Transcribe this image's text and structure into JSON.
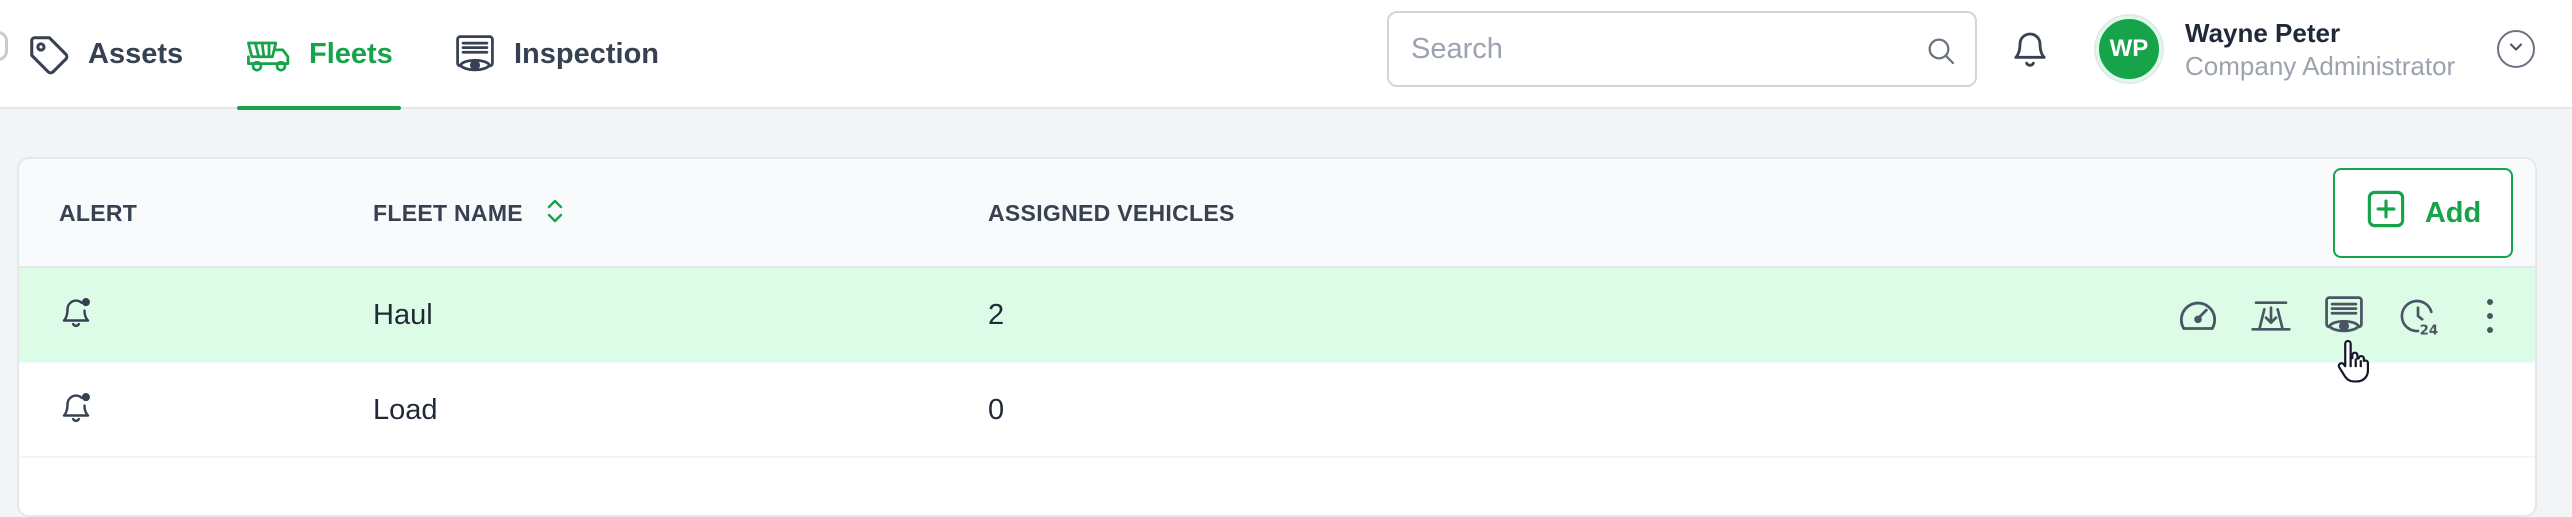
{
  "nav": {
    "tabs": [
      {
        "label": "Assets",
        "icon": "tag-icon",
        "active": false
      },
      {
        "label": "Fleets",
        "icon": "fleet-vehicle-icon",
        "active": true
      },
      {
        "label": "Inspection",
        "icon": "inspection-eye-icon",
        "active": false
      }
    ]
  },
  "search": {
    "placeholder": "Search",
    "value": ""
  },
  "user": {
    "initials": "WP",
    "name": "Wayne Peter",
    "role": "Company Administrator"
  },
  "table": {
    "columns": {
      "alert": "ALERT",
      "fleet_name": "FLEET NAME",
      "assigned_vehicles": "ASSIGNED VEHICLES"
    },
    "add_label": "Add",
    "rows": [
      {
        "alert_icon": "bell-alert-icon",
        "fleet_name": "Haul",
        "assigned_vehicles": "2",
        "highlighted": true
      },
      {
        "alert_icon": "bell-alert-icon",
        "fleet_name": "Load",
        "assigned_vehicles": "0",
        "highlighted": false
      }
    ],
    "row_actions": [
      "speedometer-icon",
      "tire-fit-icon",
      "inspection-eye-icon",
      "history-24-icon",
      "more-vertical-icon"
    ]
  },
  "colors": {
    "accent": "#16a34a",
    "row_highlight": "#dcfce7",
    "page_background": "#f3f4f6"
  }
}
